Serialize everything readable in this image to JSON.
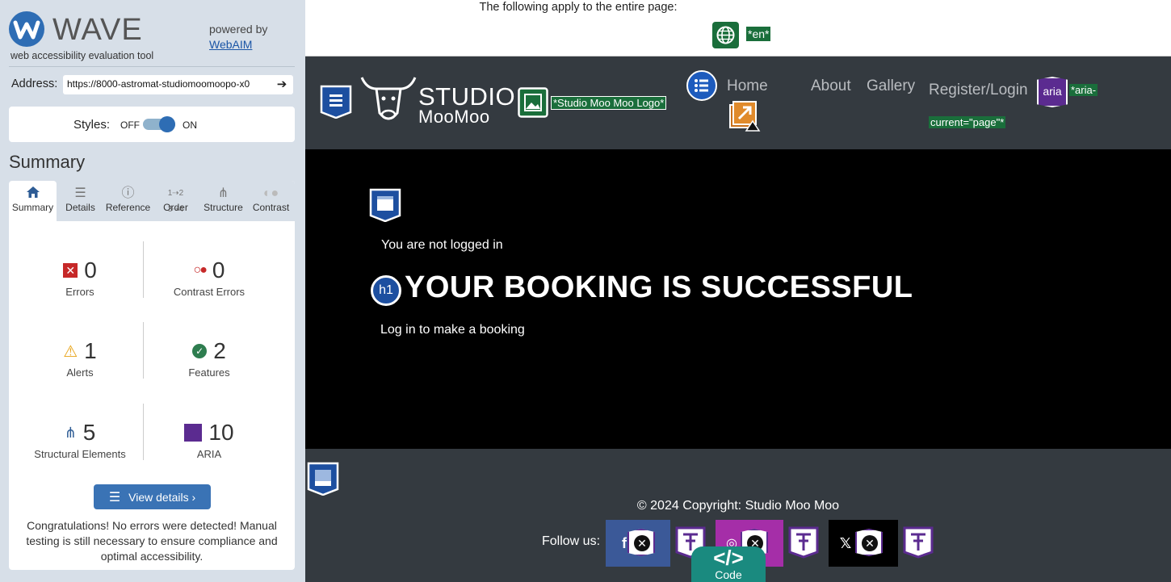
{
  "wave": {
    "title": "WAVE",
    "subtitle": "web accessibility evaluation tool",
    "powered_by": "powered by",
    "webaim_link": "WebAIM",
    "address_label": "Address:",
    "address_value": "https://8000-astromat-studiomoomoopo-x0",
    "styles_label": "Styles:",
    "styles_off": "OFF",
    "styles_on": "ON",
    "styles_enabled": true,
    "summary_heading": "Summary",
    "tabs": [
      {
        "label": "Summary",
        "icon": "home-icon",
        "active": true
      },
      {
        "label": "Details",
        "icon": "list-icon",
        "active": false
      },
      {
        "label": "Reference",
        "icon": "info-icon",
        "active": false
      },
      {
        "label": "Order",
        "icon": "order-icon",
        "active": false
      },
      {
        "label": "Structure",
        "icon": "structure-icon",
        "active": false
      },
      {
        "label": "Contrast",
        "icon": "contrast-icon",
        "active": false
      }
    ],
    "stats": {
      "errors": {
        "count": "0",
        "label": "Errors"
      },
      "contrast_errors": {
        "count": "0",
        "label": "Contrast Errors"
      },
      "alerts": {
        "count": "1",
        "label": "Alerts"
      },
      "features": {
        "count": "2",
        "label": "Features"
      },
      "structural": {
        "count": "5",
        "label": "Structural Elements"
      },
      "aria": {
        "count": "10",
        "label": "ARIA"
      }
    },
    "view_details": "View details ›",
    "congrats": "Congratulations! No errors were detected! Manual testing is still necessary to ensure compliance and optimal accessibility."
  },
  "page": {
    "notice": "The following apply to the entire page:",
    "lang_tag": "*en*",
    "logo_alt_tag": "*Studio Moo Moo Logo*",
    "logo_line1": "STUDIO",
    "logo_line2": "MooMoo",
    "nav": {
      "home": "Home",
      "about": "About",
      "gallery": "Gallery",
      "register": "Register/Login",
      "aria_badge": "aria",
      "aria_tag_1": "*aria-",
      "aria_tag_2": "current=\"page\"*"
    },
    "not_logged_in": "You are not logged in",
    "heading_badge": "h1",
    "heading": "YOUR BOOKING IS SUCCESSFUL",
    "login_prompt": "Log in to make a booking",
    "copyright": "© 2024 Copyright: Studio Moo Moo",
    "follow_us": "Follow us:",
    "social": [
      {
        "name": "facebook",
        "glyph": "f",
        "color": "#3b5998"
      },
      {
        "name": "instagram",
        "glyph": "◎",
        "color": "#a52ea8"
      },
      {
        "name": "x",
        "glyph": "𝕏",
        "color": "#000000"
      }
    ],
    "code_tab_symbol": "</>",
    "code_tab_label": "Code"
  },
  "colors": {
    "wave_blue": "#2e6db4",
    "nav_bg": "#343a40",
    "tag_green": "#1a6e3b",
    "aria_purple": "#5b2b90",
    "code_teal": "#1a8a7f"
  }
}
